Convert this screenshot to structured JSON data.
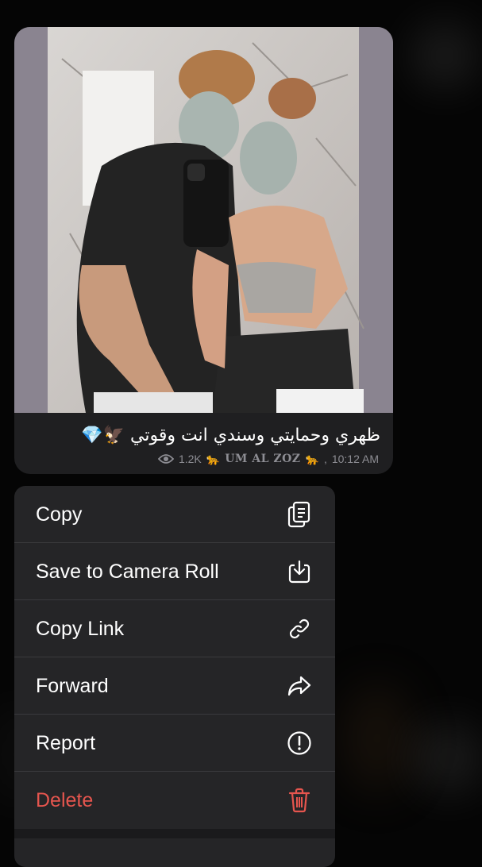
{
  "message": {
    "caption": "ظهري وحمايتي وسندي انت وقوتي 🦅💎",
    "views": "1.2K",
    "author_signature": "UM AL ZOZ",
    "author_emoji": "🐆",
    "time": "10:12 AM"
  },
  "menu": {
    "items": [
      {
        "label": "Copy",
        "icon": "copy-icon"
      },
      {
        "label": "Save to Camera Roll",
        "icon": "save-download-icon"
      },
      {
        "label": "Copy Link",
        "icon": "link-icon"
      },
      {
        "label": "Forward",
        "icon": "forward-arrow-icon"
      },
      {
        "label": "Report",
        "icon": "report-exclamation-icon"
      },
      {
        "label": "Delete",
        "icon": "trash-icon",
        "color": "#e5554e"
      }
    ]
  },
  "colors": {
    "bubble": "#1f1f21",
    "menu_background": "#252527",
    "destructive": "#e5554e",
    "meta_text": "#8d8d93"
  }
}
